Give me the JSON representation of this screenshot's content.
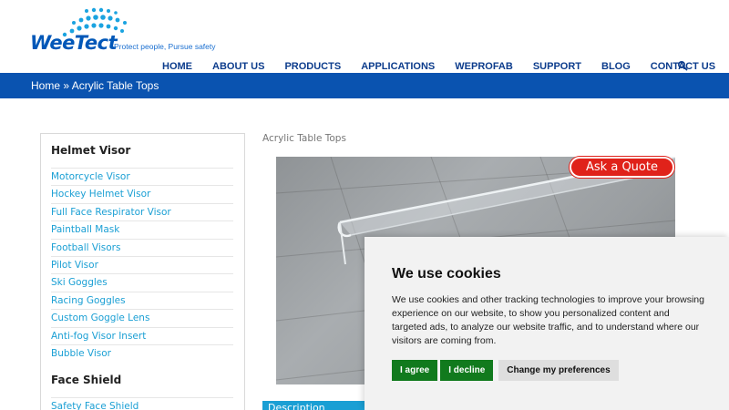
{
  "brand": {
    "name": "WeeTect",
    "tagline": "Protect people, Pursue safety"
  },
  "nav": {
    "items": [
      "HOME",
      "ABOUT US",
      "PRODUCTS",
      "APPLICATIONS",
      "WEPROFAB",
      "SUPPORT",
      "BLOG",
      "CONTACT US"
    ],
    "search_icon": "search-icon"
  },
  "breadcrumb": {
    "home": "Home",
    "sep": "»",
    "current": "Acrylic Table Tops"
  },
  "sidebar": {
    "sections": [
      {
        "heading": "Helmet Visor",
        "links": [
          "Motorcycle Visor",
          "Hockey Helmet Visor",
          "Full Face Respirator Visor",
          "Paintball Mask",
          "Football Visors",
          "Pilot Visor",
          "Ski Goggles",
          "Racing Goggles",
          "Custom Goggle Lens",
          "Anti-fog Visor Insert",
          "Bubble Visor"
        ]
      },
      {
        "heading": "Face Shield",
        "links": [
          "Safety Face Shield"
        ]
      }
    ]
  },
  "main": {
    "title": "Acrylic Table Tops",
    "quote_button": "Ask a Quote",
    "description_tab": "Description"
  },
  "cookie": {
    "title": "We use cookies",
    "text": "We use cookies and other tracking technologies to improve your browsing experience on our website, to show you personalized content and targeted ads, to analyze our website traffic, and to understand where our visitors are coming from.",
    "agree": "I agree",
    "decline": "I decline",
    "preferences": "Change my preferences"
  },
  "colors": {
    "brand_blue": "#0a53b0",
    "nav_text": "#0c3c8c",
    "link": "#1a9fd4",
    "quote_red": "#e0221a",
    "cookie_green": "#117a1d"
  }
}
